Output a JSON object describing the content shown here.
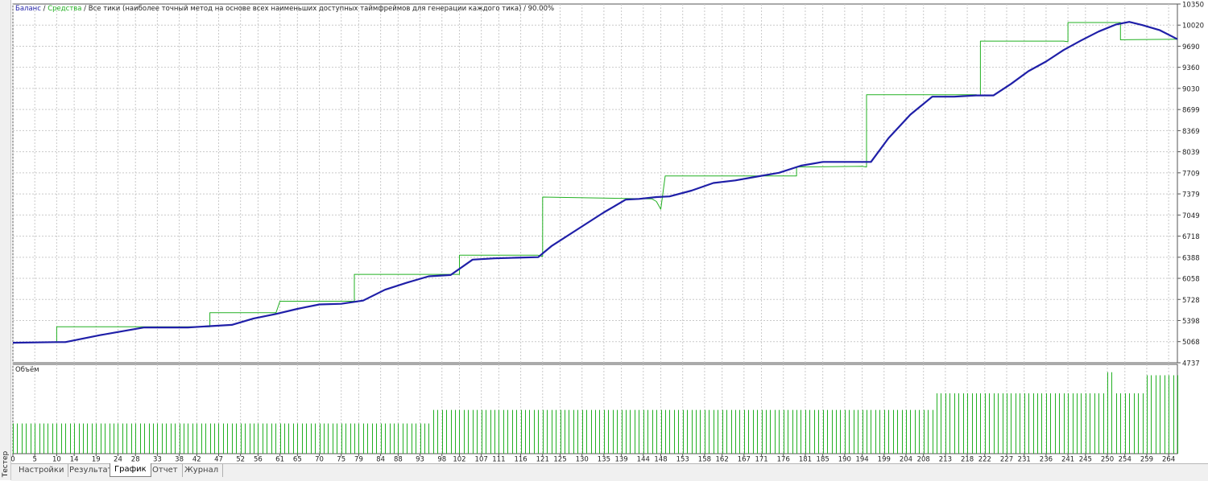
{
  "side_label": "Тестер",
  "header": {
    "balance": "Баланс",
    "equity": "Средства",
    "sep": " / ",
    "mode": "Все тики (наиболее точный метод на основе всех наименьших доступных таймфреймов для генерации каждого тика)",
    "quality": "90.00%"
  },
  "volume_label": "Объём",
  "tabs": [
    {
      "label": "Настройки",
      "active": false
    },
    {
      "label": "Результаты",
      "active": false
    },
    {
      "label": "График",
      "active": true
    },
    {
      "label": "Отчет",
      "active": false
    },
    {
      "label": "Журнал",
      "active": false
    }
  ],
  "colors": {
    "balance": "#1f1fa8",
    "equity": "#22b022",
    "volume": "#22b022",
    "grid": "#c9c9c9"
  },
  "chart_data": {
    "type": "line",
    "x_ticks": [
      "0",
      "5",
      "10",
      "14",
      "19",
      "24",
      "28",
      "33",
      "38",
      "42",
      "47",
      "52",
      "56",
      "61",
      "65",
      "70",
      "75",
      "79",
      "84",
      "88",
      "93",
      "98",
      "102",
      "107",
      "111",
      "116",
      "121",
      "125",
      "130",
      "135",
      "139",
      "144",
      "148",
      "153",
      "158",
      "162",
      "167",
      "171",
      "176",
      "181",
      "185",
      "190",
      "194",
      "199",
      "204",
      "208",
      "213",
      "218",
      "222",
      "227",
      "231",
      "236",
      "241",
      "245",
      "250",
      "254",
      "259",
      "264"
    ],
    "y_ticks": [
      "10350",
      "10020",
      "9690",
      "9360",
      "9030",
      "8699",
      "8369",
      "8039",
      "7709",
      "7379",
      "7049",
      "6718",
      "6388",
      "6058",
      "5728",
      "5398",
      "5068",
      "4737"
    ],
    "ylim": [
      4737,
      10350
    ],
    "xlim": [
      0,
      266
    ],
    "series": [
      {
        "name": "Баланс",
        "x": [
          0,
          10,
          12,
          20,
          25,
          30,
          40,
          45,
          50,
          55,
          60,
          65,
          70,
          75,
          80,
          85,
          90,
          95,
          100,
          105,
          110,
          115,
          120,
          123,
          130,
          135,
          140,
          143,
          147,
          150,
          155,
          160,
          165,
          170,
          175,
          180,
          185,
          190,
          196,
          200,
          205,
          210,
          215,
          220,
          224,
          228,
          232,
          236,
          240,
          244,
          248,
          252,
          255,
          258,
          262,
          266
        ],
        "values": [
          5050,
          5060,
          5060,
          5170,
          5230,
          5290,
          5290,
          5310,
          5330,
          5430,
          5500,
          5580,
          5650,
          5660,
          5710,
          5880,
          5990,
          6090,
          6110,
          6350,
          6370,
          6380,
          6390,
          6560,
          6870,
          7090,
          7290,
          7300,
          7330,
          7340,
          7430,
          7550,
          7590,
          7650,
          7710,
          7820,
          7880,
          7880,
          7880,
          8250,
          8620,
          8900,
          8900,
          8920,
          8920,
          9100,
          9300,
          9450,
          9630,
          9780,
          9920,
          10030,
          10070,
          10020,
          9940,
          9800
        ]
      },
      {
        "name": "Средства",
        "x": [
          0,
          10,
          10,
          45,
          45,
          60,
          60,
          61,
          62,
          78,
          78,
          90,
          96,
          102,
          102,
          120,
          121,
          121,
          146,
          147,
          148,
          149,
          151,
          179,
          179,
          194,
          195,
          195,
          220,
          221,
          221,
          240,
          241,
          241,
          251,
          253,
          253,
          266
        ],
        "values": [
          5050,
          5060,
          5300,
          5300,
          5520,
          5520,
          5500,
          5700,
          5700,
          5700,
          6120,
          6120,
          6120,
          6120,
          6420,
          6420,
          6400,
          7330,
          7300,
          7260,
          7140,
          7660,
          7660,
          7660,
          7800,
          7810,
          7800,
          8930,
          8930,
          8920,
          9770,
          9770,
          9760,
          10060,
          10060,
          10060,
          9790,
          9800
        ]
      },
      {
        "name": "Объём",
        "type": "bar",
        "levels": [
          {
            "x_from": 0,
            "x_to": 96,
            "value": 1.0
          },
          {
            "x_from": 96,
            "x_to": 211,
            "value": 1.45
          },
          {
            "x_from": 211,
            "x_to": 250,
            "value": 2.0
          },
          {
            "x_from": 250,
            "x_to": 252,
            "value": 2.7,
            "every": 1
          },
          {
            "x_from": 252,
            "x_to": 259,
            "value": 2.0
          },
          {
            "x_from": 259,
            "x_to": 266,
            "value": 2.6
          }
        ]
      }
    ]
  }
}
